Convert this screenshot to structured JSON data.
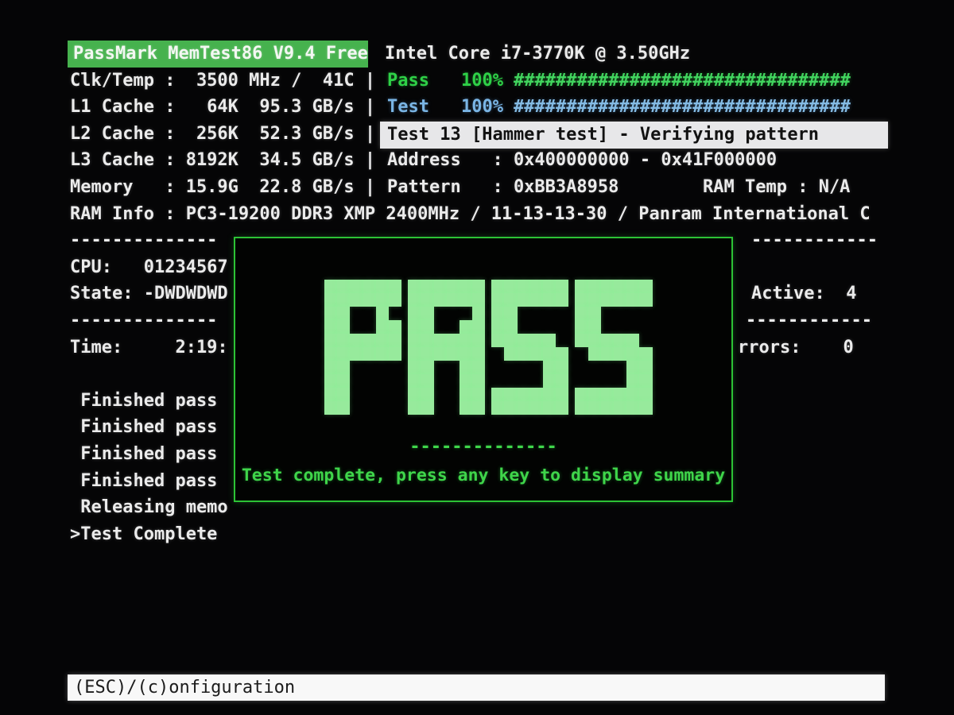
{
  "header": {
    "title": "PassMark MemTest86 V9.4 Free",
    "cpu_model": "Intel Core i7-3770K @ 3.50GHz"
  },
  "sysinfo": {
    "rows": [
      "Clk/Temp :  3500 MHz /  41C |",
      "L1 Cache :   64K  95.3 GB/s |",
      "L2 Cache :  256K  52.3 GB/s |",
      "L3 Cache : 8192K  34.5 GB/s |",
      "Memory   : 15.9G  22.8 GB/s |",
      "RAM Info : PC3-19200 DDR3 XMP 2400MHz / 11-13-13-30 / Panram International C"
    ]
  },
  "progress": {
    "pass_label": "Pass",
    "pass_percent": "100%",
    "pass_bar": "################################",
    "test_label": "Test",
    "test_percent": "100%",
    "test_bar": "################################"
  },
  "test_status": {
    "banner": "Test 13 [Hammer test] - Verifying pattern",
    "address_row": "Address   : 0x400000000 - 0x41F000000",
    "pattern_row": "Pattern   : 0xBB3A8958",
    "ram_temp": "RAM Temp : N/A"
  },
  "mid": {
    "separator_left": "--------------",
    "separator_right": "------------",
    "cpu_row": "CPU:   01234567",
    "state_row": "State: -DWDWDWD",
    "active_row": "Active:  4",
    "time_row": "Time:     2:19:",
    "errors_row": "rrors:    0"
  },
  "log": {
    "lines": [
      " Finished pass",
      " Finished pass",
      " Finished pass",
      " Finished pass",
      " Releasing memo",
      ">Test Complete"
    ]
  },
  "pass_box": {
    "big_text": "PASS",
    "divider": "--------------",
    "message": "Test complete, press any key to display summary"
  },
  "footer": {
    "hint": "(ESC)/(c)onfiguration"
  },
  "colors": {
    "background": "#050506",
    "text_white": "#ebebeb",
    "title_bar_bg": "#46b24e",
    "title_text": "#f3f7f2",
    "green": "#2ed147",
    "green_hash": "#41d45e",
    "blue": "#7ab5e5",
    "blue_hash": "#84bbe4",
    "banner_bg": "#e7e7e9",
    "banner_text": "#121212",
    "box_border": "#2cc335",
    "big_pass": "#97ea9c",
    "box_green": "#3fd54a",
    "footer_bg": "#f8f8f8",
    "footer_text": "#1c1c1c"
  }
}
